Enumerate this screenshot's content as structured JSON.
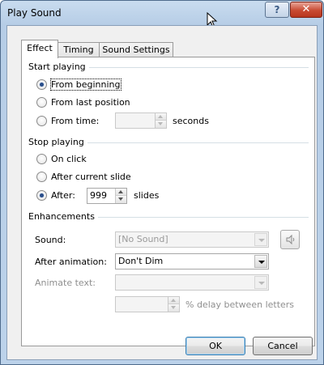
{
  "window": {
    "title": "Play Sound",
    "help_label": "?",
    "close_label": "✕"
  },
  "tabs": [
    {
      "label": "Effect",
      "active": true
    },
    {
      "label": "Timing",
      "active": false
    },
    {
      "label": "Sound Settings",
      "active": false
    }
  ],
  "start_playing": {
    "title": "Start playing",
    "from_beginning": "From beginning",
    "from_last_position": "From last position",
    "from_time": "From time:",
    "time_value": "",
    "seconds": "seconds",
    "selected": "from_beginning"
  },
  "stop_playing": {
    "title": "Stop playing",
    "on_click": "On click",
    "after_current_slide": "After current slide",
    "after": "After:",
    "after_value": "999",
    "slides": "slides",
    "selected": "after"
  },
  "enhancements": {
    "title": "Enhancements",
    "sound_label": "Sound:",
    "sound_value": "[No Sound]",
    "after_animation_label": "After animation:",
    "after_animation_value": "Don't Dim",
    "animate_text_label": "Animate text:",
    "animate_text_value": "",
    "delay_value": "",
    "delay_suffix": "% delay between letters"
  },
  "buttons": {
    "ok": "OK",
    "cancel": "Cancel"
  },
  "icons": {
    "cursor": "mouse-pointer-icon",
    "speaker": "speaker-icon"
  }
}
